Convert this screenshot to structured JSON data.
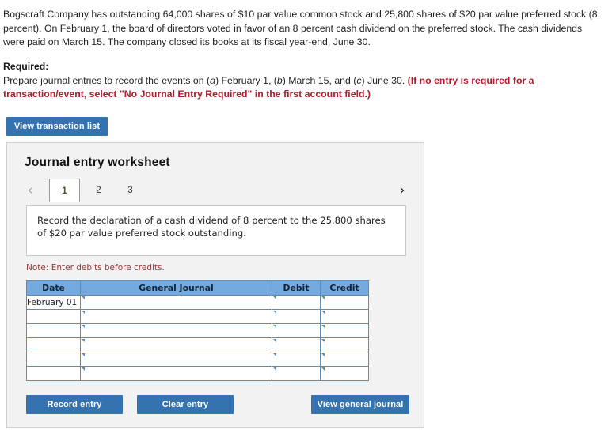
{
  "problem": {
    "statement": "Bogscraft Company has outstanding 64,000 shares of $10 par value common stock and 25,800 shares of $20 par value preferred stock (8 percent). On February 1, the board of directors voted in favor of an 8 percent cash dividend on the preferred stock. The cash dividends were paid on March 15. The company closed its books at its fiscal year-end, June 30."
  },
  "required": {
    "label": "Required:",
    "text_before_a": "Prepare journal entries to record the events on (",
    "marker_a": "a",
    "text_a_to_b": ") February 1, (",
    "marker_b": "b",
    "text_b_to_c": ") March 15, and (",
    "marker_c": "c",
    "text_after_c": ") June 30. ",
    "note_bold_red": "(If no entry is required for a transaction/event, select \"No Journal Entry Required\" in the first account field.)"
  },
  "toolbar": {
    "view_transaction_list_label": "View transaction list"
  },
  "worksheet": {
    "title": "Journal entry worksheet",
    "prev_icon": "‹",
    "next_icon": "›",
    "tabs": [
      {
        "label": "1",
        "active": true
      },
      {
        "label": "2",
        "active": false
      },
      {
        "label": "3",
        "active": false
      }
    ],
    "instruction": "Record the declaration of a cash dividend of 8 percent to the 25,800 shares of $20 par value preferred stock outstanding.",
    "note": "Note: Enter debits before credits.",
    "table": {
      "headers": [
        "Date",
        "General Journal",
        "Debit",
        "Credit"
      ],
      "rows": [
        {
          "date": "February 01",
          "general_journal": "",
          "debit": "",
          "credit": ""
        },
        {
          "date": "",
          "general_journal": "",
          "debit": "",
          "credit": ""
        },
        {
          "date": "",
          "general_journal": "",
          "debit": "",
          "credit": ""
        },
        {
          "date": "",
          "general_journal": "",
          "debit": "",
          "credit": ""
        },
        {
          "date": "",
          "general_journal": "",
          "debit": "",
          "credit": ""
        },
        {
          "date": "",
          "general_journal": "",
          "debit": "",
          "credit": ""
        }
      ]
    },
    "buttons": {
      "record_entry": "Record entry",
      "clear_entry": "Clear entry",
      "view_general_journal": "View general journal"
    }
  },
  "colors": {
    "button_blue": "#3572b0",
    "table_header_blue": "#74aade",
    "alert_red": "#b01c2e",
    "note_red": "#8c3b3b",
    "panel_gray": "#f2f2f2"
  }
}
